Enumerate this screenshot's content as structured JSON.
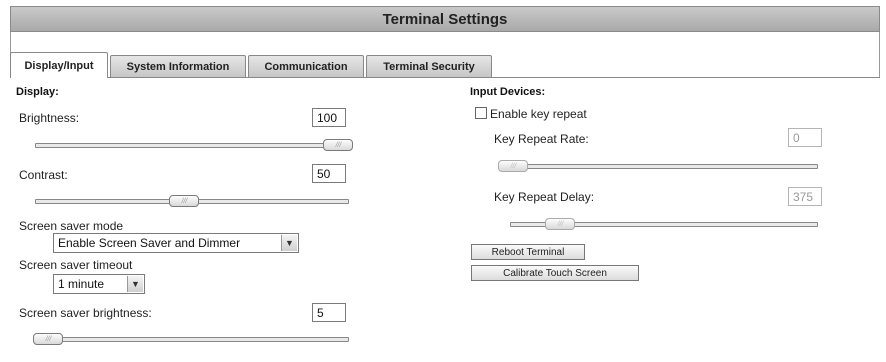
{
  "title": "Terminal Settings",
  "tabs": [
    {
      "label": "Display/Input",
      "active": true
    },
    {
      "label": "System Information",
      "active": false
    },
    {
      "label": "Communication",
      "active": false
    },
    {
      "label": "Terminal Security",
      "active": false
    }
  ],
  "display": {
    "heading": "Display:",
    "brightness": {
      "label": "Brightness:",
      "value": "100",
      "level": 1.0
    },
    "contrast": {
      "label": "Contrast:",
      "value": "50",
      "level": 0.5
    },
    "screen_saver_mode": {
      "label": "Screen saver mode",
      "value": "Enable Screen Saver and Dimmer"
    },
    "screen_saver_timeout": {
      "label": "Screen saver timeout",
      "value": "1 minute"
    },
    "screen_saver_brightness": {
      "label": "Screen saver brightness:",
      "value": "5",
      "level": 0.05
    }
  },
  "input": {
    "heading": "Input Devices:",
    "key_repeat": {
      "label": "Enable key repeat",
      "checked": false
    },
    "key_repeat_rate": {
      "label": "Key Repeat Rate:",
      "value": "0",
      "level": 0.0
    },
    "key_repeat_delay": {
      "label": "Key Repeat Delay:",
      "value": "375",
      "level": 0.28
    },
    "reboot_label": "Reboot Terminal",
    "calibrate_label": "Calibrate Touch Screen"
  },
  "icons": {
    "dropdown": "chevron-down-icon",
    "slider_grip": "grip-icon"
  }
}
